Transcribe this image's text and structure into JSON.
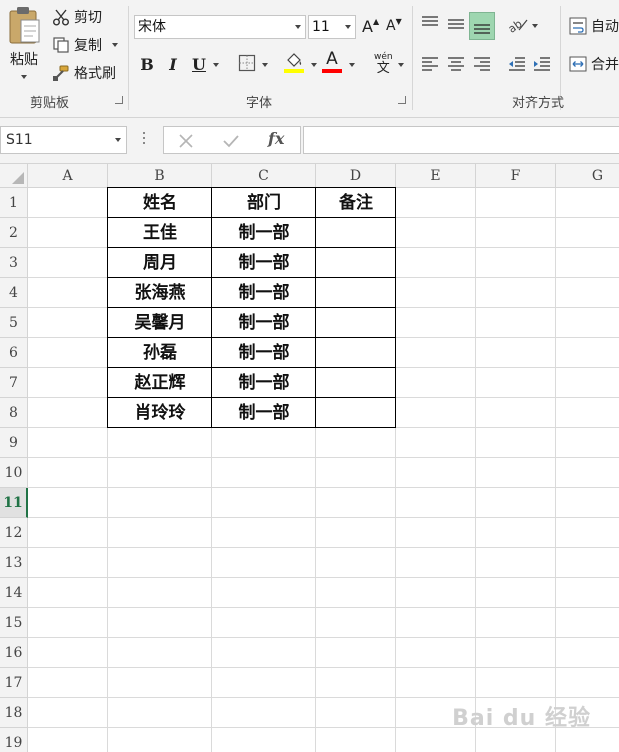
{
  "clipboard": {
    "paste_label": "粘贴",
    "cut_label": "剪切",
    "copy_label": "复制",
    "format_painter_label": "格式刷",
    "group_label": "剪贴板"
  },
  "font": {
    "name": "宋体",
    "size": "11",
    "grow_label": "A",
    "shrink_label": "A",
    "bold_label": "B",
    "italic_label": "I",
    "underline_label": "U",
    "font_color_label": "A",
    "phonetic_top": "wén",
    "phonetic_bottom": "文",
    "group_label": "字体",
    "highlight_color": "#ffff00",
    "font_color": "#ff0000"
  },
  "alignment": {
    "wrap_label": "自动",
    "merge_label": "合并",
    "group_label": "对齐方式",
    "active_color": "#9ed6b0"
  },
  "formula_bar": {
    "name_box": "S11",
    "fx_label": "fx",
    "formula_value": ""
  },
  "sheet": {
    "columns": [
      "A",
      "B",
      "C",
      "D",
      "E",
      "F",
      "G"
    ],
    "rows": [
      "1",
      "2",
      "3",
      "4",
      "5",
      "6",
      "7",
      "8",
      "9",
      "10",
      "11",
      "12",
      "13",
      "14",
      "15",
      "16",
      "17",
      "18",
      "19"
    ],
    "active_row": "11",
    "table_headers": [
      "姓名",
      "部门",
      "备注"
    ],
    "table_rows": [
      [
        "王佳",
        "制一部",
        ""
      ],
      [
        "周月",
        "制一部",
        ""
      ],
      [
        "张海燕",
        "制一部",
        ""
      ],
      [
        "吴馨月",
        "制一部",
        ""
      ],
      [
        "孙磊",
        "制一部",
        ""
      ],
      [
        "赵正辉",
        "制一部",
        ""
      ],
      [
        "肖玲玲",
        "制一部",
        ""
      ]
    ]
  },
  "watermark": "Bai du 经验"
}
